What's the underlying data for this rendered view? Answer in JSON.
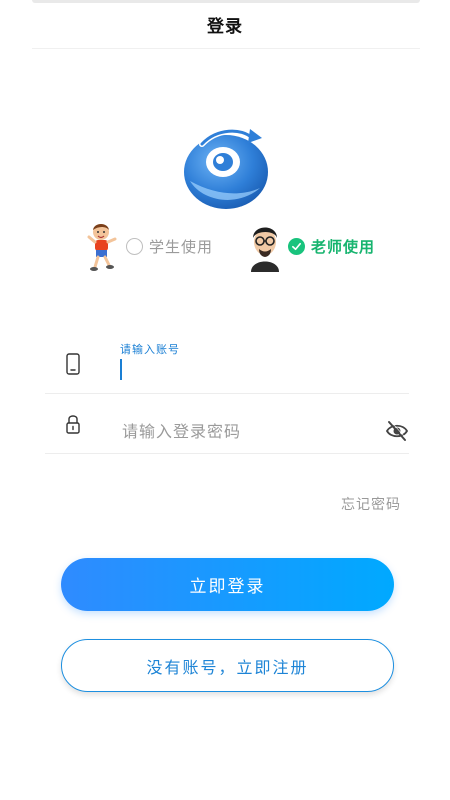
{
  "header": {
    "title": "登录"
  },
  "roles": {
    "student": {
      "label": "学生使用",
      "checked": false
    },
    "teacher": {
      "label": "老师使用",
      "checked": true
    }
  },
  "account": {
    "floating_label": "请输入账号",
    "value": ""
  },
  "password": {
    "placeholder": "请输入登录密码",
    "value": ""
  },
  "forgot_password": "忘记密码",
  "buttons": {
    "login": "立即登录",
    "register": "没有账号，立即注册"
  },
  "icons": {
    "account": "phone-icon",
    "password": "lock-icon",
    "visibility": "eye-off-icon",
    "logo": "app-logo",
    "student_avatar": "student-avatar",
    "teacher_avatar": "teacher-avatar",
    "check": "check-icon"
  },
  "colors": {
    "accent_blue": "#1a7fd4",
    "check_green": "#19c37d",
    "login_gradient_start": "#2f8bff",
    "login_gradient_end": "#00a9ff"
  }
}
